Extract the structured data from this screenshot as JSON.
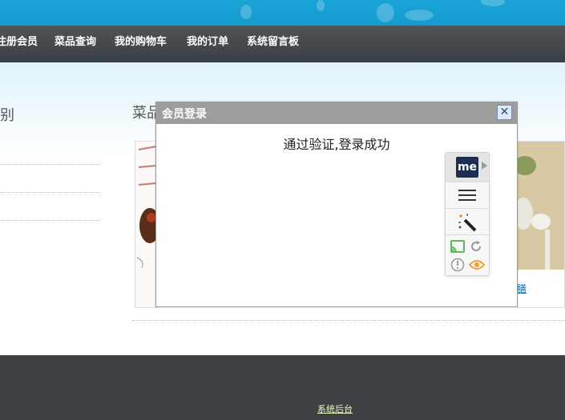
{
  "nav": {
    "items": [
      "注册会员",
      "菜品查询",
      "我的购物车",
      "我的订单",
      "系统留言板"
    ]
  },
  "sidebar": {
    "title": "别"
  },
  "main": {
    "title": "菜品",
    "card_link": "膳"
  },
  "footer": {
    "admin_link": "系统后台"
  },
  "modal": {
    "title": "会员登录",
    "close_symbol": "✕",
    "message": "通过验证,登录成功"
  },
  "toolbar": {
    "logo_text": "me",
    "icons": [
      "me-logo-icon",
      "menu-icon",
      "magic-wand-icon",
      "cast-icon",
      "refresh-icon",
      "alert-icon",
      "eye-icon"
    ]
  },
  "colors": {
    "banner": "#1aa3d6",
    "nav": "#44494d",
    "footer": "#3c4144",
    "modal_header": "#9d9d9b",
    "footer_link": "#f2f7c2"
  }
}
